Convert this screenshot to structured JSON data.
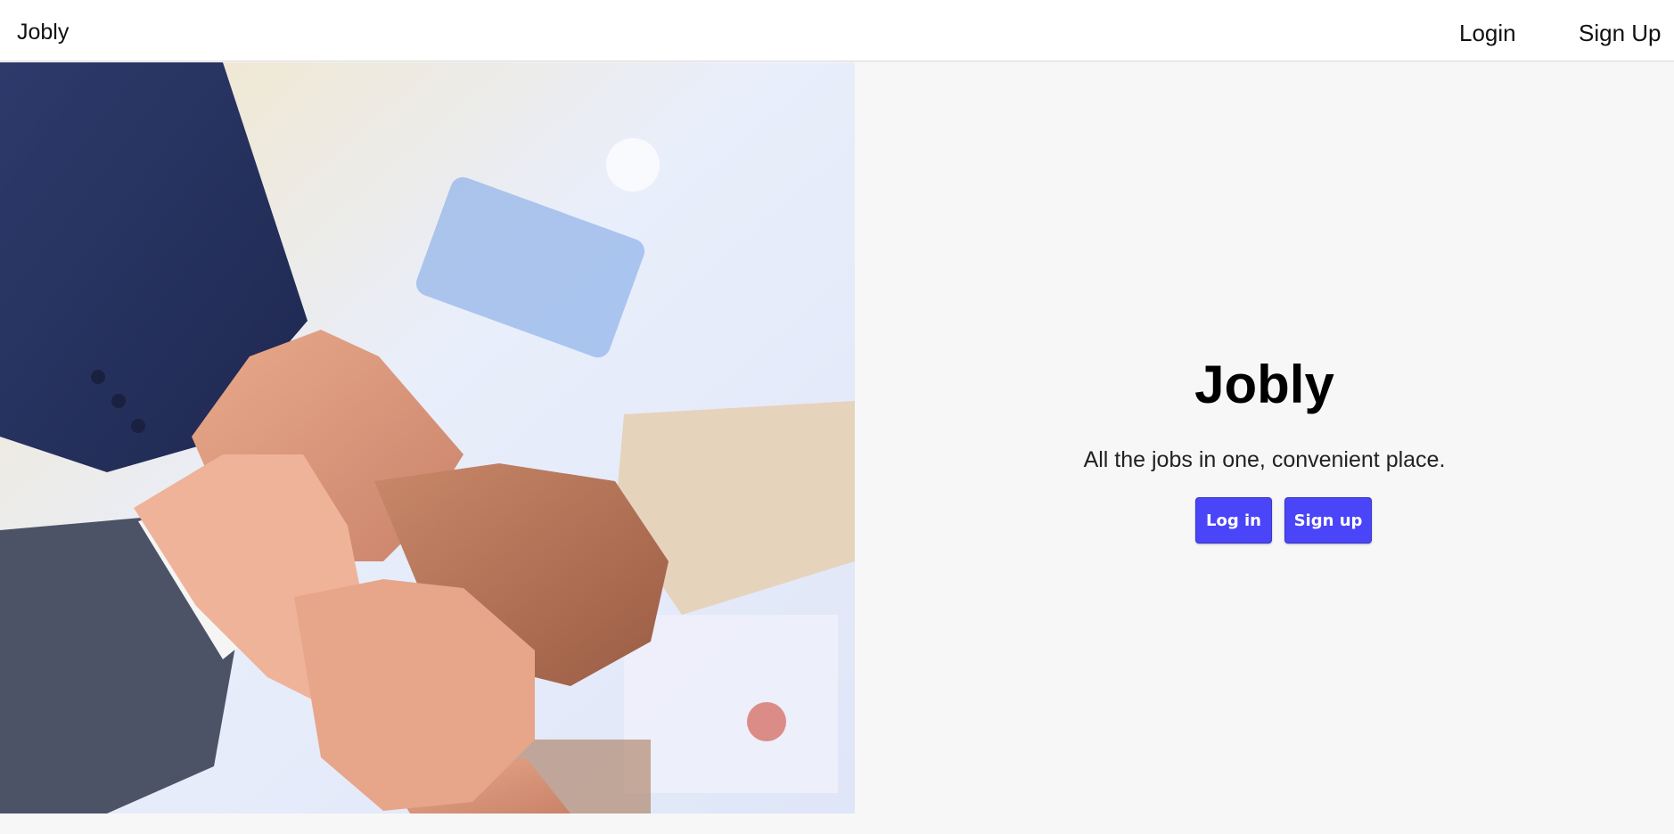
{
  "navbar": {
    "brand": "Jobly",
    "login_label": "Login",
    "signup_label": "Sign Up"
  },
  "hero": {
    "title": "Jobly",
    "tagline": "All the jobs in one, convenient place.",
    "login_button": "Log in",
    "signup_button": "Sign up",
    "image_description_name": "team-hands-photo"
  },
  "colors": {
    "accent": "#4a45f8",
    "background": "#f7f7f7",
    "navbar": "#ffffff"
  }
}
